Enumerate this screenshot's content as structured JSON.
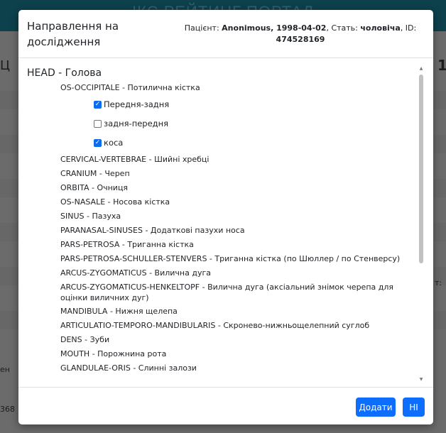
{
  "background": {
    "header_title": "ІКС РЕЙТИНГ ПОРТАЛ",
    "side_texts": [
      "Ц",
      "1",
      "т:",
      "ен",
      "368"
    ]
  },
  "modal": {
    "title": "Направлення на дослідження",
    "patient": {
      "prefix": "Пацієнт:",
      "name": "Anonimous, 1998-04-02",
      "sex_label": ", Стать:",
      "sex": "чоловіча",
      "id_label": ", ID:",
      "id": "474528169"
    },
    "tree": {
      "root": "HEAD - Голова",
      "items": [
        {
          "label": "OS-OCCIPITALE - Потилична кістка",
          "children": [
            {
              "label": "Передня-задня",
              "checked": true
            },
            {
              "label": "задня-передня",
              "checked": false
            },
            {
              "label": "коса",
              "checked": true
            }
          ]
        },
        {
          "label": "CERVICAL-VERTEBRAE - Шийні хребці"
        },
        {
          "label": "CRANIUM - Череп"
        },
        {
          "label": "ORBITA - Очниця"
        },
        {
          "label": "OS-NASALE - Носова кістка"
        },
        {
          "label": "SINUS - Пазуха"
        },
        {
          "label": "PARANASAL-SINUSES - Додаткові пазухи носа"
        },
        {
          "label": "PARS-PETROSA - Триганна кістка"
        },
        {
          "label": "PARS-PETROSA-SCHULLER-STENVERS - Триганна кістка (по Шюллер / по Стенверсу)"
        },
        {
          "label": "ARCUS-ZYGOMATICUS - Вилична дуга"
        },
        {
          "label": "ARCUS-ZYGOMATICUS-HENKELTOPF - Вилична дуга (аксіальний знімок черепа для оцінки виличних дуг)"
        },
        {
          "label": "MANDIBULA - Нижня щелепа"
        },
        {
          "label": "ARTICULATIO-TEMPORO-MANDIBULARIS - Скронево-нижньощелепний суглоб"
        },
        {
          "label": "DENS - Зуби"
        },
        {
          "label": "MOUTH - Порожнина рота"
        },
        {
          "label": "GLANDULAE-ORIS - Слинні залози"
        }
      ]
    },
    "buttons": {
      "add": "Додати",
      "no": "НІ"
    },
    "colors": {
      "primary": "#0d6efd",
      "checkbox": "#0b6cf0",
      "header_bg": "#0f4a57"
    }
  }
}
